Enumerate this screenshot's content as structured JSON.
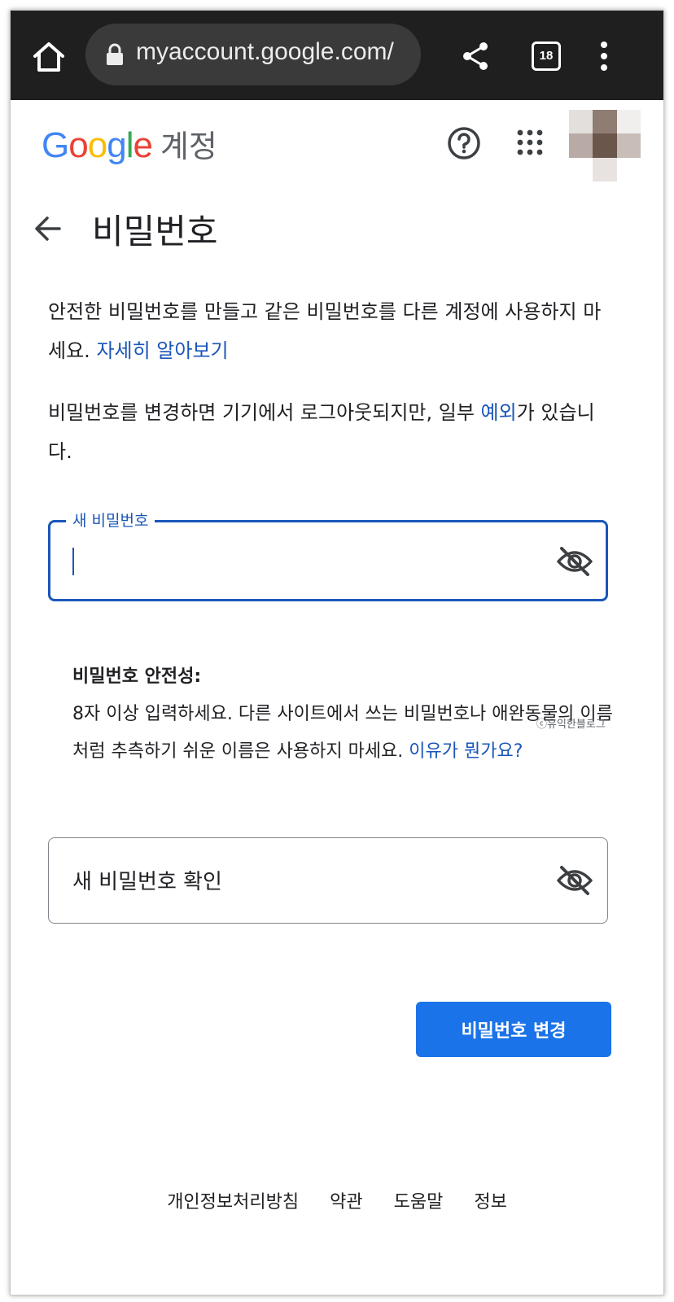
{
  "browser": {
    "url": "myaccount.google.com/",
    "tab_count": "18",
    "icons": [
      "home-icon",
      "lock-icon",
      "share-icon",
      "tabs-icon",
      "more-vert-icon"
    ]
  },
  "header": {
    "logo_letters": [
      {
        "ch": "G",
        "color": "#4285F4"
      },
      {
        "ch": "o",
        "color": "#EA4335"
      },
      {
        "ch": "o",
        "color": "#FBBC05"
      },
      {
        "ch": "g",
        "color": "#4285F4"
      },
      {
        "ch": "l",
        "color": "#34A853"
      },
      {
        "ch": "e",
        "color": "#EA4335"
      }
    ],
    "product": "계정",
    "icons": [
      "help-icon",
      "apps-icon",
      "avatar"
    ]
  },
  "page": {
    "title": "비밀번호",
    "para1_text": "안전한 비밀번호를 만들고 같은 비밀번호를 다른 계정에 사용하지 마세요.",
    "para1_link": "자세히 알아보기",
    "para2_before": "비밀번호를 변경하면 기기에서 로그아웃되지만, 일부 ",
    "para2_link": "예외",
    "para2_after": "가 있습니다."
  },
  "form": {
    "new_password_label": "새 비밀번호",
    "new_password_value": "",
    "strength_heading": "비밀번호 안전성:",
    "strength_text": "8자 이상 입력하세요. 다른 사이트에서 쓰는 비밀번호나 애완동물의 이름처럼 추측하기 쉬운 이름은 사용하지 마세요.",
    "strength_link": "이유가 뭔가요?",
    "confirm_placeholder": "새 비밀번호 확인",
    "submit_label": "비밀번호 변경"
  },
  "watermark": "ⓒ유익한블로그",
  "footer": {
    "links": [
      "개인정보처리방침",
      "약관",
      "도움말",
      "정보"
    ]
  },
  "colors": {
    "accent": "#1a73e8",
    "link": "#1a56b8",
    "topbar": "#1f1f1f"
  }
}
